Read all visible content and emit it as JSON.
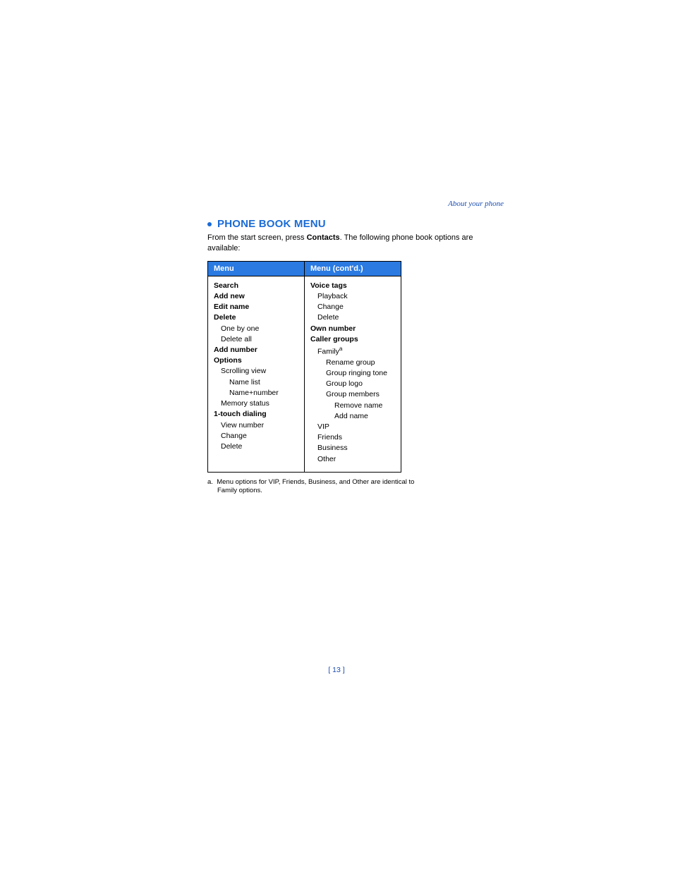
{
  "header": {
    "section_link": "About your phone"
  },
  "title": "PHONE BOOK MENU",
  "intro": {
    "prefix": "From the start screen, press ",
    "bold": "Contacts",
    "suffix": ". The following phone book options are available:"
  },
  "table": {
    "headers": [
      "Menu",
      "Menu (cont'd.)"
    ],
    "left": [
      {
        "t": "Search",
        "b": true,
        "lvl": 0
      },
      {
        "t": "Add new",
        "b": true,
        "lvl": 0
      },
      {
        "t": "Edit name",
        "b": true,
        "lvl": 0
      },
      {
        "t": "Delete",
        "b": true,
        "lvl": 0
      },
      {
        "t": "One by one",
        "b": false,
        "lvl": 1
      },
      {
        "t": "Delete all",
        "b": false,
        "lvl": 1
      },
      {
        "t": "Add number",
        "b": true,
        "lvl": 0
      },
      {
        "t": "Options",
        "b": true,
        "lvl": 0
      },
      {
        "t": "Scrolling view",
        "b": false,
        "lvl": 1
      },
      {
        "t": "Name list",
        "b": false,
        "lvl": 2
      },
      {
        "t": "Name+number",
        "b": false,
        "lvl": 2
      },
      {
        "t": "Memory status",
        "b": false,
        "lvl": 1
      },
      {
        "t": "1-touch dialing",
        "b": true,
        "lvl": 0
      },
      {
        "t": "View number",
        "b": false,
        "lvl": 1
      },
      {
        "t": "Change",
        "b": false,
        "lvl": 1
      },
      {
        "t": "Delete",
        "b": false,
        "lvl": 1
      }
    ],
    "right": [
      {
        "t": "Voice tags",
        "b": true,
        "lvl": 0
      },
      {
        "t": "Playback",
        "b": false,
        "lvl": 1
      },
      {
        "t": "Change",
        "b": false,
        "lvl": 1
      },
      {
        "t": "Delete",
        "b": false,
        "lvl": 1
      },
      {
        "t": "Own number",
        "b": true,
        "lvl": 0
      },
      {
        "t": "Caller groups",
        "b": true,
        "lvl": 0
      },
      {
        "t": "Family",
        "b": false,
        "lvl": 1,
        "sup": "a"
      },
      {
        "t": "Rename group",
        "b": false,
        "lvl": 2
      },
      {
        "t": "Group ringing tone",
        "b": false,
        "lvl": 2
      },
      {
        "t": "Group logo",
        "b": false,
        "lvl": 2
      },
      {
        "t": "Group members",
        "b": false,
        "lvl": 2
      },
      {
        "t": "Remove name",
        "b": false,
        "lvl": 3
      },
      {
        "t": "Add name",
        "b": false,
        "lvl": 3
      },
      {
        "t": "VIP",
        "b": false,
        "lvl": 1
      },
      {
        "t": "Friends",
        "b": false,
        "lvl": 1
      },
      {
        "t": "Business",
        "b": false,
        "lvl": 1
      },
      {
        "t": "Other",
        "b": false,
        "lvl": 1
      }
    ]
  },
  "footnote": {
    "marker": "a.",
    "text": "Menu options for VIP, Friends, Business, and Other are identical to Family options."
  },
  "page_number": "[ 13 ]"
}
